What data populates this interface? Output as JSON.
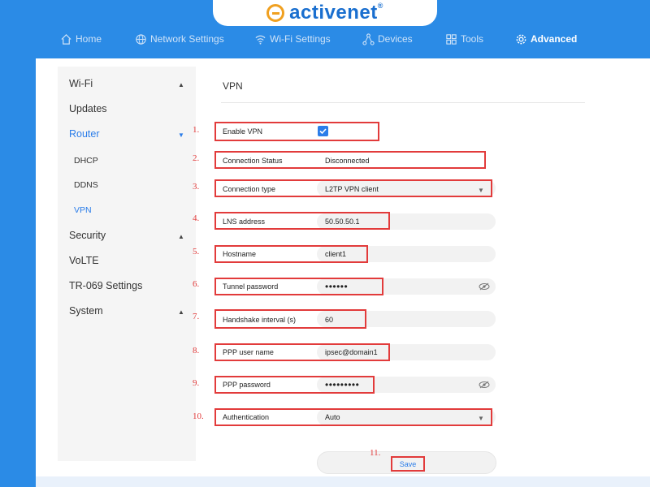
{
  "brand": {
    "name": "activenet",
    "mark": "®",
    "logo_color": "#f0a020",
    "text_color": "#1a6fcf"
  },
  "nav": [
    {
      "label": "Home",
      "icon": "home-icon"
    },
    {
      "label": "Network Settings",
      "icon": "globe-icon"
    },
    {
      "label": "Wi-Fi Settings",
      "icon": "wifi-icon"
    },
    {
      "label": "Devices",
      "icon": "devices-icon"
    },
    {
      "label": "Tools",
      "icon": "tools-icon"
    },
    {
      "label": "Advanced",
      "icon": "gear-icon",
      "active": true
    }
  ],
  "sidebar": {
    "items": [
      {
        "label": "Wi-Fi",
        "expandable": true
      },
      {
        "label": "Updates"
      },
      {
        "label": "Router",
        "expanded": true,
        "active": true
      },
      {
        "label": "DHCP",
        "sub": true
      },
      {
        "label": "DDNS",
        "sub": true
      },
      {
        "label": "VPN",
        "sub": true,
        "active": true
      },
      {
        "label": "Security",
        "expandable": true
      },
      {
        "label": "VoLTE"
      },
      {
        "label": "TR-069 Settings"
      },
      {
        "label": "System",
        "expandable": true
      }
    ]
  },
  "page": {
    "title": "VPN"
  },
  "form": {
    "fields": [
      {
        "num": "1.",
        "label": "Enable VPN",
        "type": "checkbox",
        "checked": true
      },
      {
        "num": "2.",
        "label": "Connection Status",
        "value": "Disconnected"
      },
      {
        "num": "3.",
        "label": "Connection type",
        "value": "L2TP VPN client",
        "type": "select"
      },
      {
        "num": "4.",
        "label": "LNS address",
        "value": "50.50.50.1"
      },
      {
        "num": "5.",
        "label": "Hostname",
        "value": "client1"
      },
      {
        "num": "6.",
        "label": "Tunnel password",
        "value": "••••••",
        "type": "password"
      },
      {
        "num": "7.",
        "label": "Handshake interval (s)",
        "value": "60"
      },
      {
        "num": "8.",
        "label": "PPP user name",
        "value": "ipsec@domain1"
      },
      {
        "num": "9.",
        "label": "PPP password",
        "value": "•••••••••",
        "type": "password"
      },
      {
        "num": "10.",
        "label": "Authentication",
        "value": "Auto",
        "type": "select"
      }
    ],
    "save": {
      "num": "11.",
      "label": "Save"
    }
  },
  "colors": {
    "header_bg": "#2b8be6",
    "accent": "#2b7de9",
    "highlight": "#e23b3b",
    "sidebar_bg": "#f5f5f5"
  }
}
